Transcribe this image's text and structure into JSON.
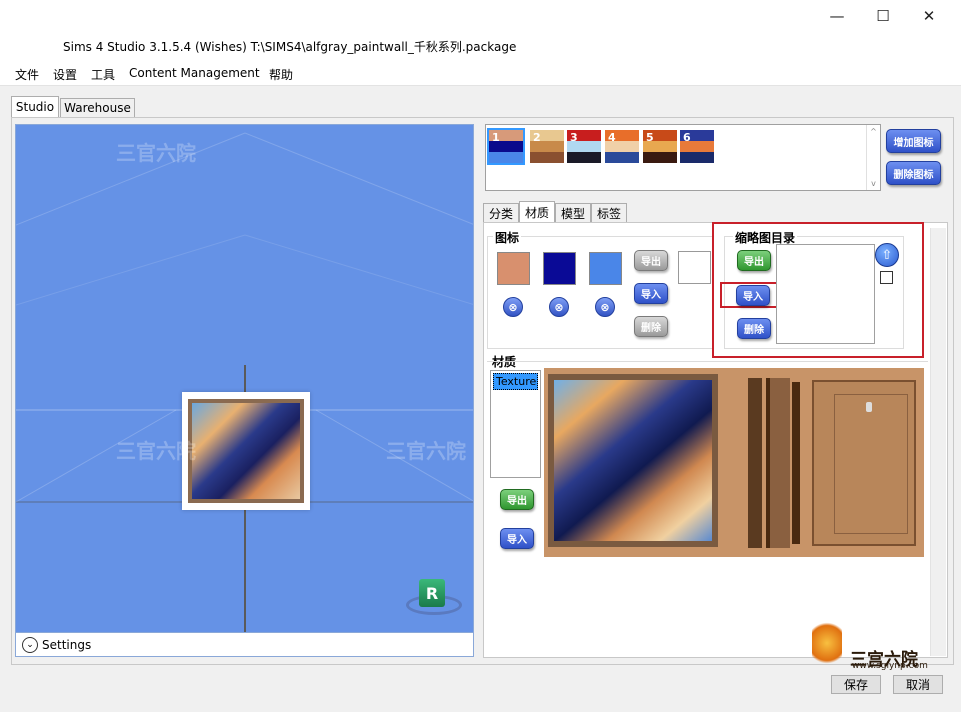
{
  "window": {
    "title": "Sims 4 Studio 3.1.5.4 (Wishes)  T:\\SIMS4\\alfgray_paintwall_千秋系列.package",
    "minimize": "—",
    "maximize": "☐",
    "close": "✕"
  },
  "menu": [
    "文件",
    "设置",
    "工具",
    "Content Management",
    "帮助"
  ],
  "tabs": [
    "Studio",
    "Warehouse"
  ],
  "viewport": {
    "settings_label": "Settings",
    "gizmo_letter": "R",
    "watermark": "三官六院",
    "watermark_url": "www.sglynp.com"
  },
  "swatches": [
    {
      "label": "1",
      "top": "#d79a7a",
      "mid": "#0a0a8c",
      "bot": "#4a86e8"
    },
    {
      "label": "2",
      "top": "#e8c890",
      "mid": "#c88a4a",
      "bot": "#8a5030"
    },
    {
      "label": "3",
      "top": "#c81e1e",
      "mid": "#b0d8f0",
      "bot": "#1a1a28"
    },
    {
      "label": "4",
      "top": "#e86e2a",
      "mid": "#f0d0a8",
      "bot": "#2a4a9a"
    },
    {
      "label": "5",
      "top": "#c84a18",
      "mid": "#e8a850",
      "bot": "#3a1a10"
    },
    {
      "label": "6",
      "top": "#2a3a9a",
      "mid": "#e87a3a",
      "bot": "#1a2a6a"
    }
  ],
  "swatch_buttons": {
    "add": "增加图标",
    "remove": "删除图标"
  },
  "subtabs": [
    "分类",
    "材质",
    "模型",
    "标签"
  ],
  "icon_group": {
    "label": "图标",
    "colors": [
      "#d8906e",
      "#0a0a96",
      "#4a86e8"
    ],
    "delete_glyph": "⊗",
    "export": "导出",
    "import": "导入",
    "delete": "删除"
  },
  "thumbnail_group": {
    "label": "缩略图目录",
    "export": "导出",
    "import": "导入",
    "delete": "删除"
  },
  "material_group": {
    "label": "材质",
    "list_items": [
      "Texture"
    ],
    "export": "导出",
    "import": "导入"
  },
  "footer": {
    "save": "保存",
    "cancel": "取消",
    "brand": "三宫六院",
    "brand_url": "www.sglynp.com"
  },
  "colors": {
    "accent": "#6592e6",
    "highlight_red": "#c8202a"
  }
}
